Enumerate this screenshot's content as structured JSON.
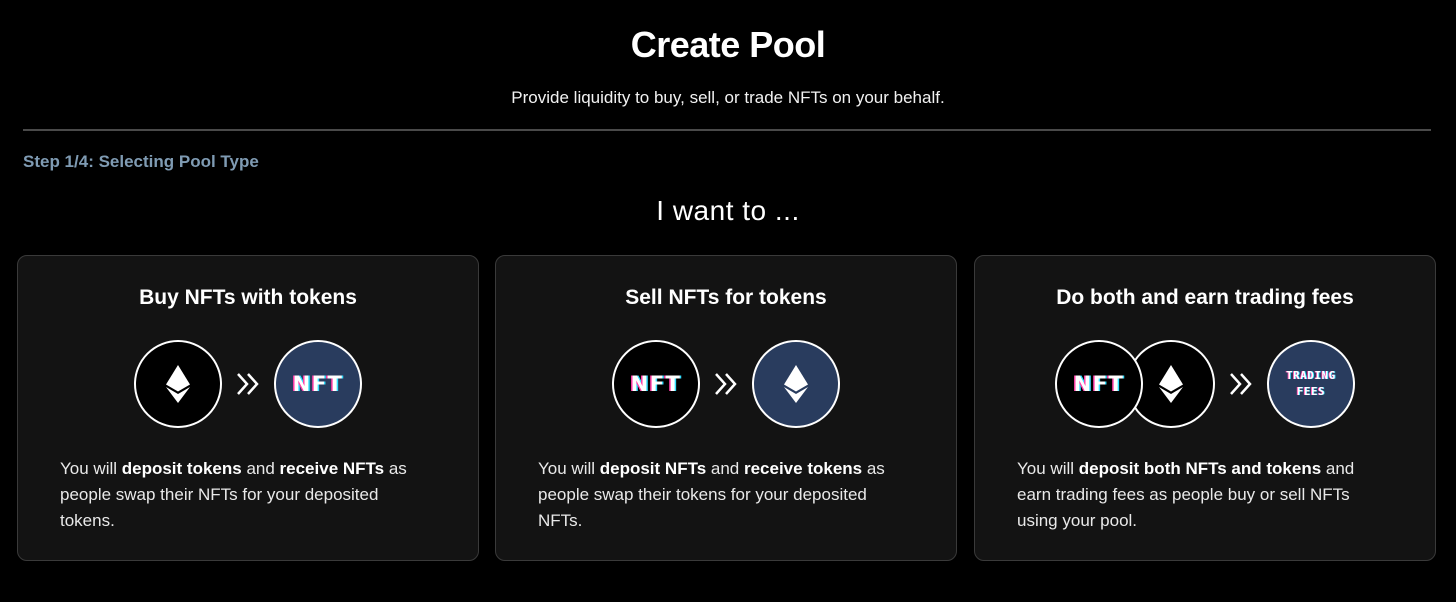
{
  "header": {
    "title": "Create Pool",
    "subtitle": "Provide liquidity to buy, sell, or trade NFTs on your behalf."
  },
  "step_label": "Step 1/4: Selecting Pool Type",
  "prompt": "I want to ...",
  "cards": [
    {
      "title": "Buy NFTs with tokens",
      "icons": [
        "ethereum-icon",
        "double-chevron-right-icon",
        "nft-badge-icon"
      ],
      "nft_label": "NFT",
      "desc": [
        "You will ",
        "deposit tokens",
        " and ",
        "receive NFTs",
        " as people swap their NFTs for your deposited tokens."
      ]
    },
    {
      "title": "Sell NFTs for tokens",
      "icons": [
        "nft-badge-icon",
        "double-chevron-right-icon",
        "ethereum-icon"
      ],
      "nft_label": "NFT",
      "desc": [
        "You will ",
        "deposit NFTs",
        " and ",
        "receive tokens",
        " as people swap their tokens for your deposited NFTs."
      ]
    },
    {
      "title": "Do both and earn trading fees",
      "icons": [
        "nft-badge-icon",
        "ethereum-icon",
        "double-chevron-right-icon",
        "trading-fees-icon"
      ],
      "nft_label": "NFT",
      "fees_label_1": "TRADING",
      "fees_label_2": "FEES",
      "desc": [
        "You will ",
        "deposit both NFTs and tokens",
        " and earn trading fees as people buy or sell NFTs using your pool."
      ]
    }
  ],
  "colors": {
    "background": "#000000",
    "card_bg": "#131313",
    "card_border": "#3a3a3a",
    "accent_blue": "#293c5e",
    "step_text": "#7f9bb3",
    "nft_glitch_pink": "#ff3fa8",
    "nft_glitch_cyan": "#35e0ff"
  }
}
